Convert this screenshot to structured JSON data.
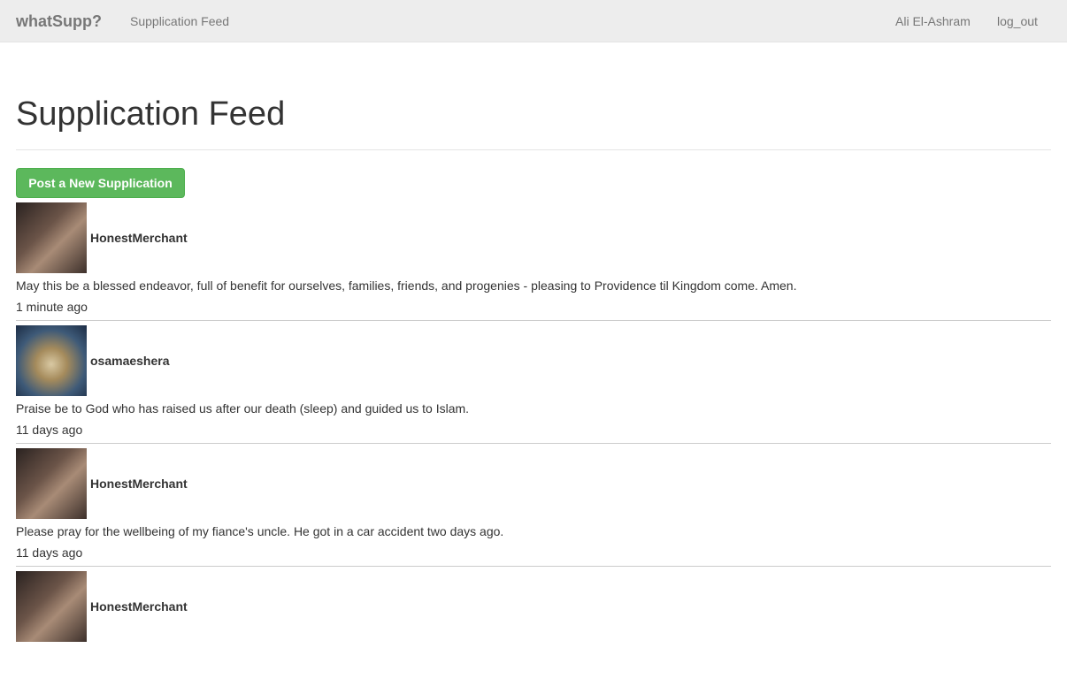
{
  "navbar": {
    "brand": "whatSupp?",
    "feed_link": "Supplication Feed",
    "user_name": "Ali El-Ashram",
    "logout": "log_out"
  },
  "page": {
    "title": "Supplication Feed",
    "post_button": "Post a New Supplication"
  },
  "feed": [
    {
      "username": "HonestMerchant",
      "avatar": "bearded-man-avatar",
      "message": "May this be a blessed endeavor, full of benefit for ourselves, families, friends, and progenies - pleasing to Providence til Kingdom come. Amen.",
      "time": "1 minute ago"
    },
    {
      "username": "osamaeshera",
      "avatar": "lion-avatar",
      "message": "Praise be to God who has raised us after our death (sleep) and guided us to Islam.",
      "time": "11 days ago"
    },
    {
      "username": "HonestMerchant",
      "avatar": "bearded-man-avatar",
      "message": "Please pray for the wellbeing of my fiance's uncle. He got in a car accident two days ago.",
      "time": "11 days ago"
    },
    {
      "username": "HonestMerchant",
      "avatar": "bearded-man-avatar",
      "message": "",
      "time": ""
    }
  ]
}
